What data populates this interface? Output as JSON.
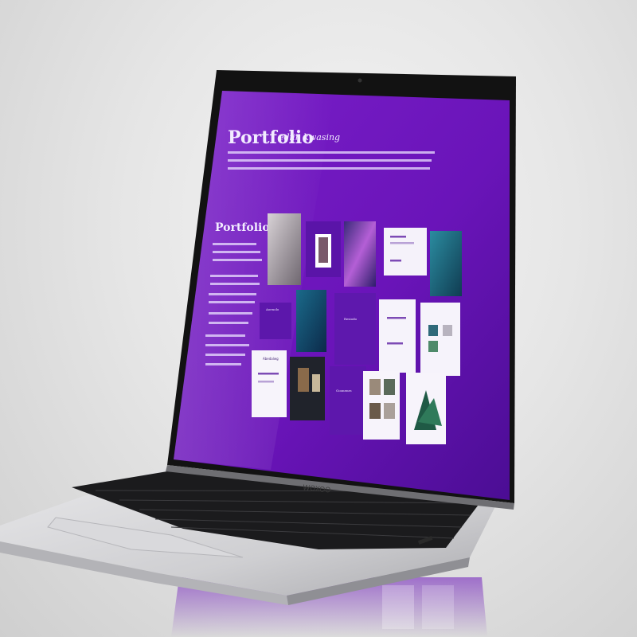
{
  "screen": {
    "hero_title": "Portfolio",
    "hero_subtitle": "ediin kwasing",
    "side_title": "Portfolio",
    "card_labels": [
      "Aoenolo",
      "Resiodo",
      "Abedalwg",
      "Goonenrs"
    ]
  },
  "laptop": {
    "brand": "WOXOO"
  },
  "colors": {
    "screen_purple": "#6a17b8",
    "screen_purple_deep": "#4e0f95",
    "bezel": "#151515",
    "aluminium": "#c9c9cc"
  }
}
